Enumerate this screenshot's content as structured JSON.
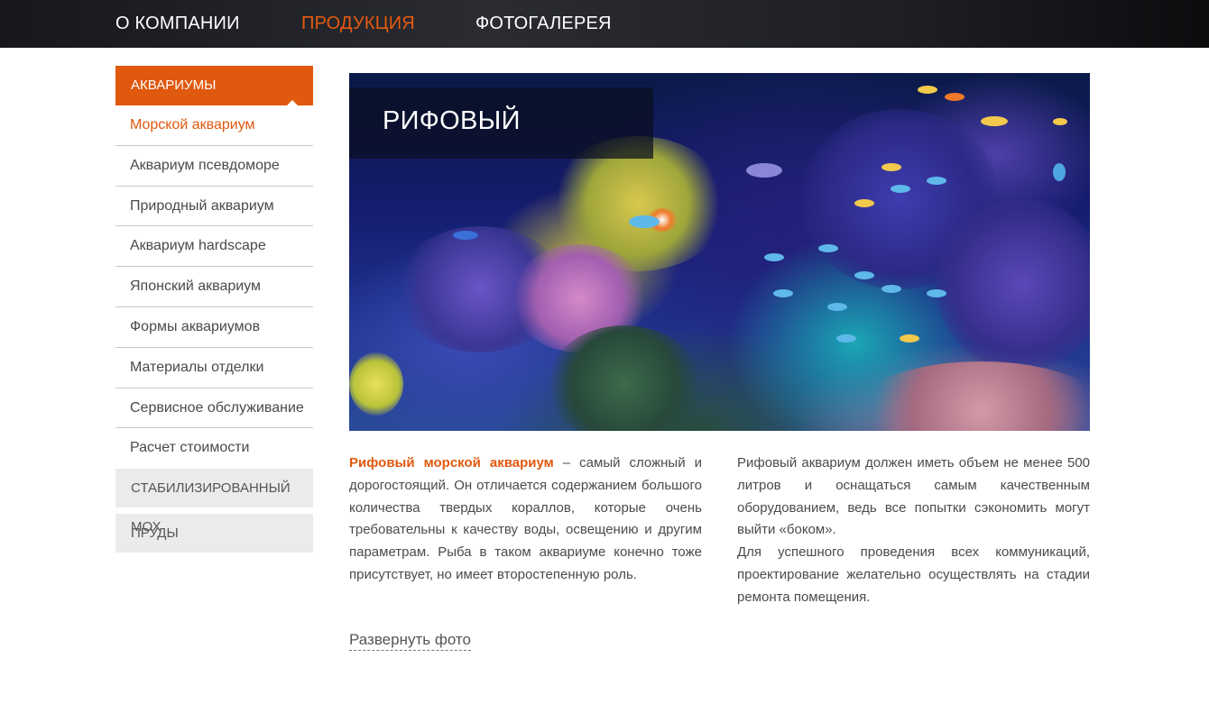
{
  "nav": {
    "items": [
      {
        "label": "О КОМПАНИИ",
        "active": false
      },
      {
        "label": "ПРОДУКЦИЯ",
        "active": true
      },
      {
        "label": "ФОТОГАЛЕРЕЯ",
        "active": false
      }
    ]
  },
  "sidebar": {
    "header": "АКВАРИУМЫ",
    "links": [
      {
        "label": "Морской аквариум",
        "current": true
      },
      {
        "label": "Аквариум псевдоморе",
        "current": false
      },
      {
        "label": "Природный аквариум",
        "current": false
      },
      {
        "label": "Аквариум hardscape",
        "current": false
      },
      {
        "label": "Японский аквариум",
        "current": false
      },
      {
        "label": "Формы аквариумов",
        "current": false
      },
      {
        "label": "Материалы отделки",
        "current": false
      },
      {
        "label": "Сервисное обслуживание",
        "current": false
      },
      {
        "label": "Расчет стоимости",
        "current": false
      }
    ],
    "categories": [
      "СТАБИЛИЗИРОВАННЫЙ МОХ",
      "ПРУДЫ"
    ]
  },
  "hero": {
    "title": "РИФОВЫЙ"
  },
  "content": {
    "left": {
      "highlight": "Рифовый морской аквариум",
      "text": " – самый сложный и дорогостоящий. Он отличается содержанием большого количества твердых кораллов, которые очень требовательны к качеству воды, освещению и другим параметрам. Рыба в таком аквариуме конечно тоже присутствует, но имеет второстепенную роль."
    },
    "right": {
      "p1": "Рифовый аквариум должен иметь объем не менее 500 литров и оснащаться самым качественным оборудованием, ведь все попытки сэкономить могут выйти «боком».",
      "p2": "Для успешного проведения всех коммуникаций, проектирование желательно осуществлять на стадии ремонта помещения."
    },
    "expand_label": "Развернуть фото"
  },
  "colors": {
    "accent": "#e0590e",
    "topbar": "#1e1f23",
    "sidebar_category_bg": "#ebebeb"
  }
}
